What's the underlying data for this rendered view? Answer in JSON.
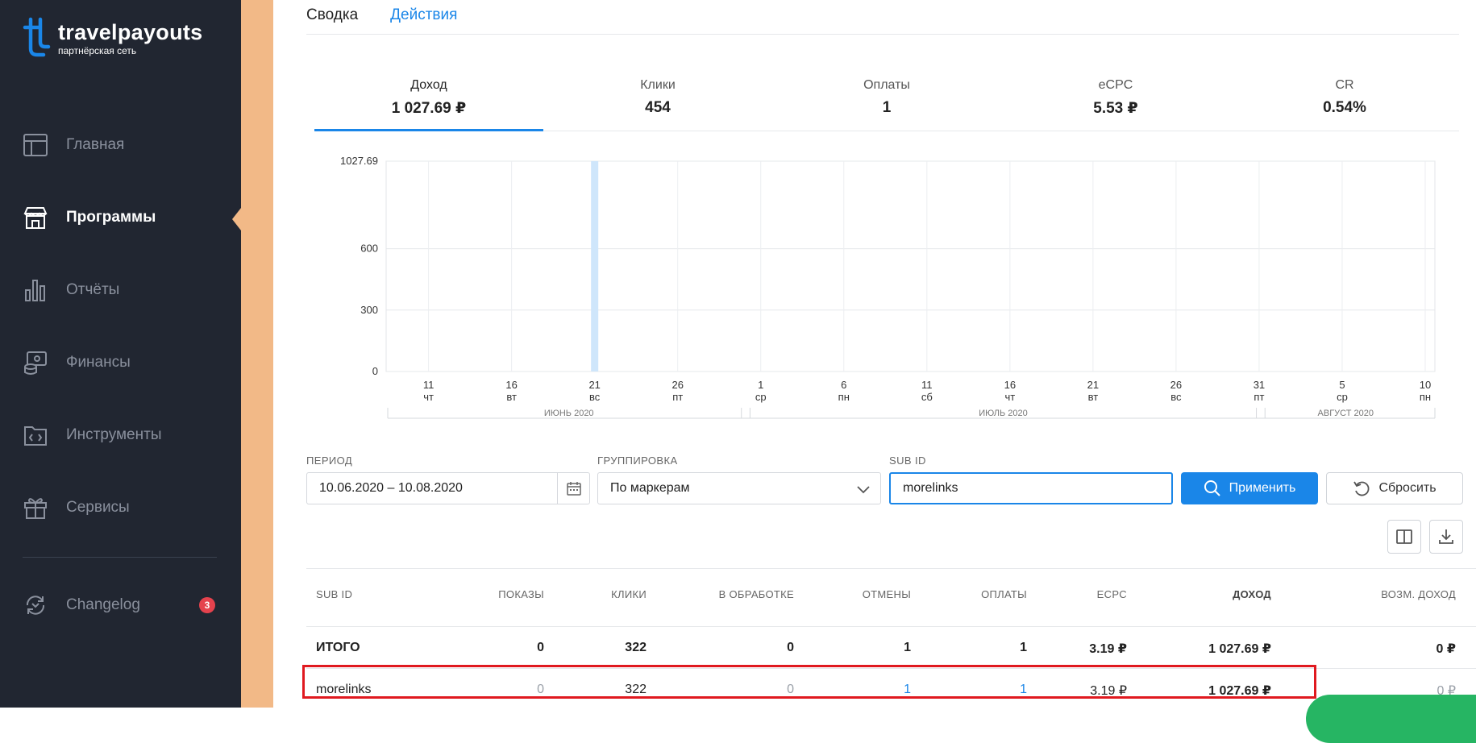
{
  "brand": {
    "name": "travelpayouts",
    "subtitle": "партнёрская сеть"
  },
  "sidebar": {
    "items": [
      {
        "label": "Главная",
        "icon": "layout-icon"
      },
      {
        "label": "Программы",
        "icon": "store-icon"
      },
      {
        "label": "Отчёты",
        "icon": "bar-chart-icon"
      },
      {
        "label": "Финансы",
        "icon": "finance-icon"
      },
      {
        "label": "Инструменты",
        "icon": "tools-folder-icon"
      },
      {
        "label": "Сервисы",
        "icon": "gift-icon"
      },
      {
        "label": "Changelog",
        "icon": "changelog-icon"
      }
    ],
    "active_index": 1,
    "changelog_badge": "3"
  },
  "tabs": {
    "summary": "Сводка",
    "actions": "Действия"
  },
  "metrics": [
    {
      "label": "Доход",
      "value": "1 027.69 ₽"
    },
    {
      "label": "Клики",
      "value": "454"
    },
    {
      "label": "Оплаты",
      "value": "1"
    },
    {
      "label": "eCPC",
      "value": "5.53 ₽"
    },
    {
      "label": "CR",
      "value": "0.54%"
    }
  ],
  "chart_data": {
    "type": "bar",
    "x": [
      "2020-06-10",
      "2020-06-11",
      "2020-06-12",
      "2020-06-13",
      "2020-06-14",
      "2020-06-15",
      "2020-06-16",
      "2020-06-17",
      "2020-06-18",
      "2020-06-19",
      "2020-06-20",
      "2020-06-21",
      "2020-06-22",
      "2020-06-23",
      "2020-06-24",
      "2020-06-25",
      "2020-06-26",
      "2020-06-27",
      "2020-06-28",
      "2020-06-29",
      "2020-06-30",
      "2020-07-01",
      "2020-07-02",
      "2020-07-03",
      "2020-07-04",
      "2020-07-05",
      "2020-07-06",
      "2020-07-07",
      "2020-07-08",
      "2020-07-09",
      "2020-07-10",
      "2020-07-11",
      "2020-07-12",
      "2020-07-13",
      "2020-07-14",
      "2020-07-15",
      "2020-07-16",
      "2020-07-17",
      "2020-07-18",
      "2020-07-19",
      "2020-07-20",
      "2020-07-21",
      "2020-07-22",
      "2020-07-23",
      "2020-07-24",
      "2020-07-25",
      "2020-07-26",
      "2020-07-27",
      "2020-07-28",
      "2020-07-29",
      "2020-07-30",
      "2020-07-31",
      "2020-08-01",
      "2020-08-02",
      "2020-08-03",
      "2020-08-04",
      "2020-08-05",
      "2020-08-06",
      "2020-08-07",
      "2020-08-08",
      "2020-08-09",
      "2020-08-10"
    ],
    "values": [
      0,
      0,
      0,
      0,
      0,
      0,
      0,
      0,
      0,
      0,
      0,
      1027.69,
      0,
      0,
      0,
      0,
      0,
      0,
      0,
      0,
      0,
      0,
      0,
      0,
      0,
      0,
      0,
      0,
      0,
      0,
      0,
      0,
      0,
      0,
      0,
      0,
      0,
      0,
      0,
      0,
      0,
      0,
      0,
      0,
      0,
      0,
      0,
      0,
      0,
      0,
      0,
      0,
      0,
      0,
      0,
      0,
      0,
      0,
      0,
      0,
      0,
      0
    ],
    "ylim": [
      0,
      1027.69
    ],
    "yticks": [
      "0",
      "300",
      "600",
      "1027.69"
    ],
    "xticks": [
      {
        "day": "11",
        "weekday": "чт"
      },
      {
        "day": "16",
        "weekday": "вт"
      },
      {
        "day": "21",
        "weekday": "вс"
      },
      {
        "day": "26",
        "weekday": "пт"
      },
      {
        "day": "1",
        "weekday": "ср"
      },
      {
        "day": "6",
        "weekday": "пн"
      },
      {
        "day": "11",
        "weekday": "сб"
      },
      {
        "day": "16",
        "weekday": "чт"
      },
      {
        "day": "21",
        "weekday": "вт"
      },
      {
        "day": "26",
        "weekday": "вс"
      },
      {
        "day": "31",
        "weekday": "пт"
      },
      {
        "day": "5",
        "weekday": "ср"
      },
      {
        "day": "10",
        "weekday": "пн"
      }
    ],
    "months": [
      "ИЮНЬ 2020",
      "ИЮЛЬ 2020",
      "АВГУСТ 2020"
    ],
    "grid": true,
    "bar_color": "#cfe6fb"
  },
  "filters": {
    "period_label": "ПЕРИОД",
    "period_value": "10.06.2020 – 10.08.2020",
    "grouping_label": "ГРУППИРОВКА",
    "grouping_value": "По маркерам",
    "subid_label": "SUB ID",
    "subid_value": "morelinks",
    "apply_label": "Применить",
    "reset_label": "Сбросить"
  },
  "table": {
    "headers": [
      "SUB ID",
      "ПОКАЗЫ",
      "КЛИКИ",
      "В ОБРАБОТКЕ",
      "ОТМЕНЫ",
      "ОПЛАТЫ",
      "ECPC",
      "ДОХОД",
      "ВОЗМ. ДОХОД"
    ],
    "total": [
      "ИТОГО",
      "0",
      "322",
      "0",
      "1",
      "1",
      "3.19 ₽",
      "1 027.69 ₽",
      "0 ₽"
    ],
    "rows": [
      [
        "morelinks",
        "0",
        "322",
        "0",
        "1",
        "1",
        "3.19 ₽",
        "1 027.69 ₽",
        "0 ₽"
      ]
    ]
  },
  "colors": {
    "sidebar": "#212631",
    "accent": "#1a86e8",
    "stripe": "#f2b987",
    "highlight": "#e0191f"
  }
}
